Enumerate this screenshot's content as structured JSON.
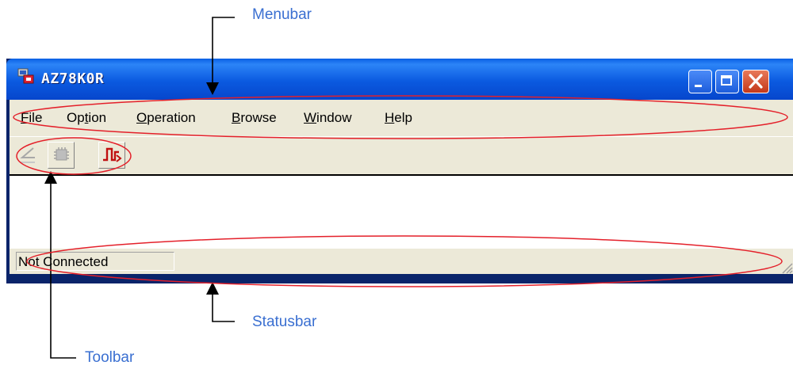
{
  "callouts": {
    "menubar": "Menubar",
    "statusbar": "Statusbar",
    "toolbar": "Toolbar"
  },
  "window": {
    "title": "AZ78K0R",
    "app_icon": "app-icon",
    "controls": [
      "minimize-icon",
      "maximize-icon",
      "close-icon"
    ]
  },
  "menubar": {
    "items": [
      {
        "pre": "",
        "key": "F",
        "post": "ile"
      },
      {
        "pre": "Op",
        "key": "t",
        "post": "ion"
      },
      {
        "pre": "",
        "key": "O",
        "post": "peration"
      },
      {
        "pre": "",
        "key": "B",
        "post": "rowse"
      },
      {
        "pre": "",
        "key": "W",
        "post": "indow"
      },
      {
        "pre": "",
        "key": "H",
        "post": "elp"
      }
    ]
  },
  "toolbar": {
    "buttons": [
      {
        "icon": "connect-icon",
        "enabled": false
      },
      {
        "icon": "chip-icon",
        "enabled": false
      },
      {
        "icon": "signal-icon",
        "enabled": true
      }
    ]
  },
  "statusbar": {
    "text": "Not Connected"
  },
  "colors": {
    "callout_text": "#3a6fd1",
    "highlight_ellipse": "#e4202a",
    "titlebar": "#0b5ae0",
    "face": "#ece9d8"
  }
}
